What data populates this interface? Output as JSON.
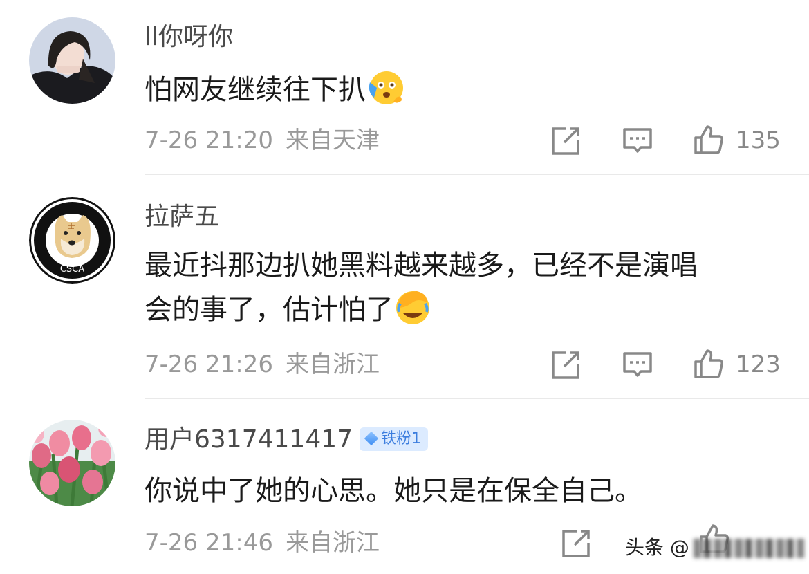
{
  "comments": [
    {
      "username": "ll你呀你",
      "text": "怕网友继续往下扒",
      "emoji": "scared-face-emoji",
      "date": "7-26 21:20",
      "location": "来自天津",
      "likes": "135"
    },
    {
      "username": "拉萨五",
      "text_line1": "最近抖那边扒她黑料越来越多，已经不是演唱",
      "text_line2": "会的事了，估计怕了",
      "emoji": "facepalm-laugh-emoji",
      "avatar_text": "CSCA",
      "date": "7-26 21:26",
      "location": "来自浙江",
      "likes": "123"
    },
    {
      "username": "用户6317411417",
      "badge": "铁粉1",
      "text": "你说中了她的心思。她只是在保全自己。",
      "date": "7-26 21:46",
      "location": "来自浙江"
    }
  ],
  "watermark": {
    "prefix": "头条 @"
  },
  "icons": [
    "share-icon",
    "comment-icon",
    "thumbs-up-icon"
  ],
  "colors": {
    "meta_text": "#999999",
    "badge_bg": "#dcebff",
    "badge_text": "#3b7dde"
  }
}
